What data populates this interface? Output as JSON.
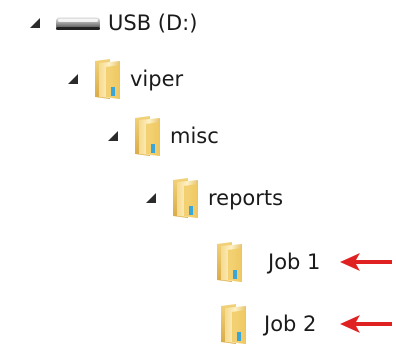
{
  "tree": {
    "drive": {
      "label": "USB (D:)",
      "icon": "usb-drive-icon",
      "expanded": true
    },
    "viper": {
      "label": "viper",
      "icon": "folder-icon",
      "expanded": true
    },
    "misc": {
      "label": "misc",
      "icon": "folder-icon",
      "expanded": true
    },
    "reports": {
      "label": "reports",
      "icon": "folder-icon",
      "expanded": true
    },
    "job1": {
      "label": "Job 1",
      "icon": "folder-icon"
    },
    "job2": {
      "label": "Job 2",
      "icon": "folder-icon"
    }
  },
  "annotations": {
    "arrow_color": "#e02121"
  },
  "colors": {
    "folder_light": "#fbe7a1",
    "folder_dark": "#e0b95c",
    "folder_accent": "#3aa6d8",
    "expander": "#2b2b2b"
  }
}
